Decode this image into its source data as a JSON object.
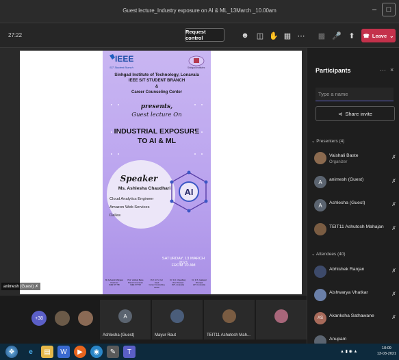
{
  "window": {
    "title": "Guest lecture_Industry exposure on AI & ML_13March _10.00am"
  },
  "toolbar": {
    "timer": "27:22",
    "request_control_label": "Request control",
    "leave_label": "Leave"
  },
  "poster": {
    "logo_text": "IEEE",
    "logo_sub": "SIT Student Branch",
    "partner_logo_text": "Sinhgad Institutes",
    "institute": "Sinhgad Institute of Technology, Lonavala",
    "branch": "IEEE SIT STUDENT BRANCH",
    "amp": "&",
    "cell": "Career Counseling Center",
    "presents": "presents,",
    "guest_lecture": "Guest lecture On",
    "headline1": "INDUSTRIAL EXPOSURE",
    "headline2": "TO AI & ML",
    "speaker_label": "Speaker",
    "speaker_name": "Ms. Ashlesha Chaudhari",
    "speaker_role1": "Cloud Analytics Engineer",
    "speaker_role2": "Amazon Web Services",
    "speaker_city": "Dallas",
    "date_line": "SATURDAY, 13 MARCH 2021",
    "time_line": "FROM 10 AM",
    "ai_text": "AI",
    "footer": [
      {
        "name": "Mr Ashutosh Mahajan",
        "role": "Chairman",
        "sub": "IEEE SIT SB"
      },
      {
        "name": "Prof. Vaishali Baste",
        "role": "Branch Counselor",
        "sub": "IEEE SIT SB"
      },
      {
        "name": "Prof. M. S. Kori",
        "role": "Head",
        "sub": "Career Counselling Center"
      },
      {
        "name": "Dr. S.D. Chaudhary",
        "role": "Vice Principal",
        "sub": "(SIT, Lonavala)"
      },
      {
        "name": "Dr. M.S. Gaikwad",
        "role": "Principal",
        "sub": "(SIT, Lonavala)"
      }
    ]
  },
  "stage": {
    "presenter_label": "animesh (Guest)"
  },
  "sidebar": {
    "header": "Participants",
    "search_placeholder": "Type a name",
    "share_label": "Share invite",
    "presenters_label": "Presenters (4)",
    "attendees_label": "Attendees (40)",
    "presenters": [
      {
        "name": "Vaishali Baste",
        "role": "Organizer",
        "initial": "",
        "color": "#8b6a4f"
      },
      {
        "name": "animesh (Guest)",
        "role": "",
        "initial": "A",
        "color": "#5b6470"
      },
      {
        "name": "Ashlesha (Guest)",
        "role": "",
        "initial": "A",
        "color": "#5b6470"
      },
      {
        "name": "TEIT11 Ashutosh Mahajan",
        "role": "",
        "initial": "",
        "color": "#7a5c42"
      }
    ],
    "attendees": [
      {
        "name": "Abhishek Ranjan",
        "initial": "",
        "color": "#3d4a6a"
      },
      {
        "name": "Aishwarya Vhatkar",
        "initial": "",
        "color": "#6a7fa8"
      },
      {
        "name": "Akanksha Sathawane",
        "initial": "AS",
        "color": "#a86a5a"
      },
      {
        "name": "Anupam",
        "initial": "",
        "color": "#5b6470"
      }
    ]
  },
  "gallery": {
    "overflow_count": "+38",
    "tiles": [
      {
        "name": "Ashlesha (Guest)",
        "initial": "A"
      },
      {
        "name": "Mayur Raut",
        "initial": ""
      },
      {
        "name": "TEIT11 Ashutosh Mah...",
        "initial": ""
      },
      {
        "name": "",
        "initial": ""
      }
    ]
  },
  "taskbar": {
    "time": "10:09",
    "date": "13-03-2021"
  }
}
